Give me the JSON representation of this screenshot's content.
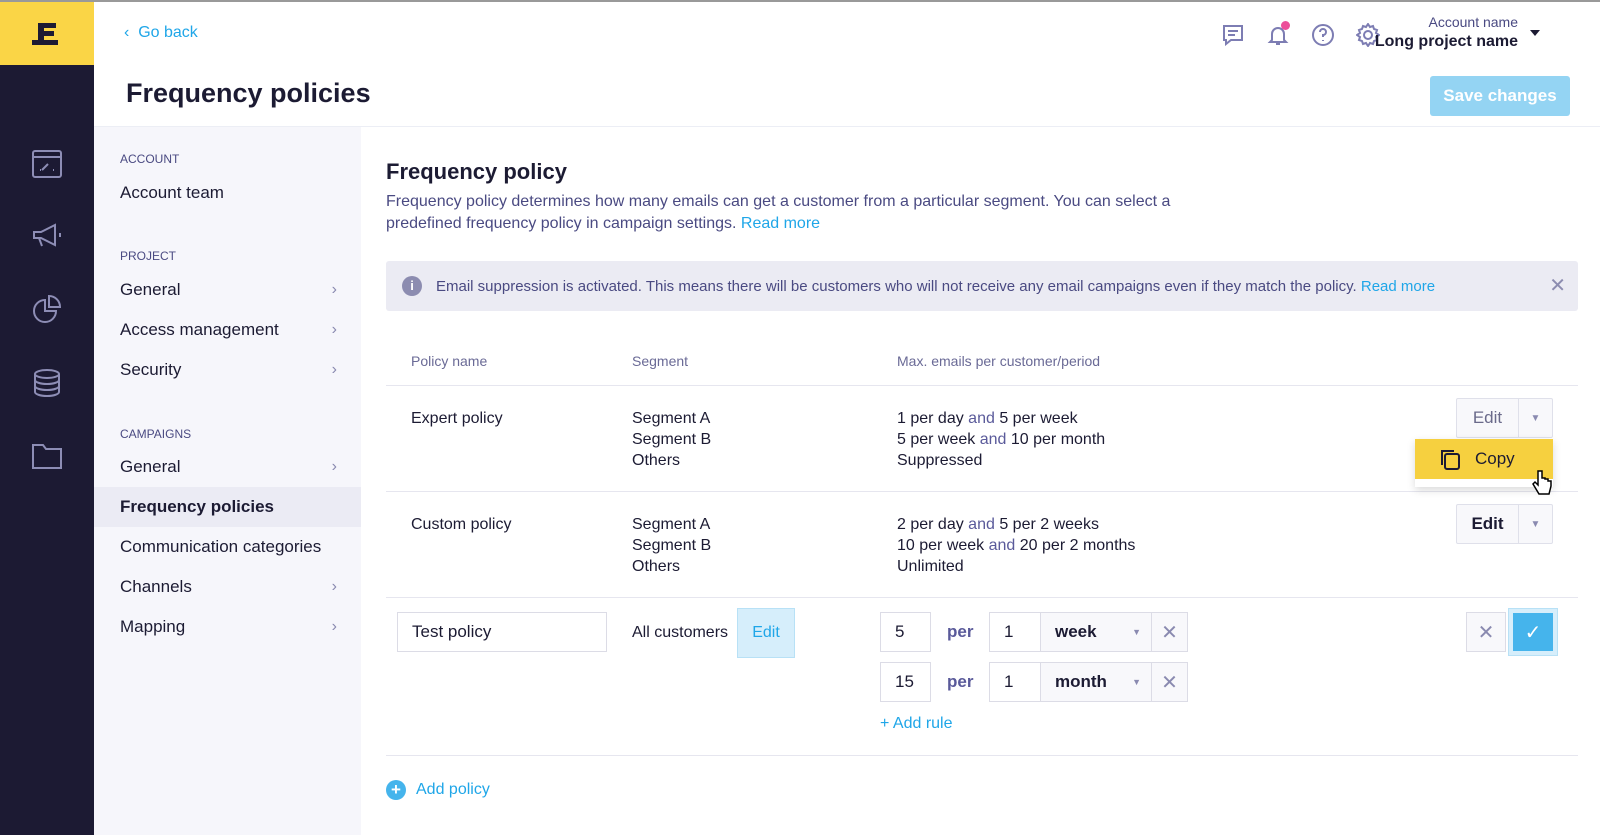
{
  "logo": "E",
  "rail": {
    "icons": [
      "dashboard-icon",
      "megaphone-icon",
      "pie-chart-icon",
      "database-icon",
      "folder-icon"
    ]
  },
  "header": {
    "go_back": "Go back",
    "title": "Frequency policies",
    "account_name": "Account name",
    "project_name": "Long project name",
    "save_label": "Save changes",
    "icons": [
      "chat-icon",
      "bell-icon",
      "help-icon",
      "gear-icon"
    ]
  },
  "sidebar": {
    "sections": [
      {
        "label": "ACCOUNT",
        "items": [
          {
            "label": "Account team"
          }
        ]
      },
      {
        "label": "PROJECT",
        "items": [
          {
            "label": "General"
          },
          {
            "label": "Access management"
          },
          {
            "label": "Security"
          }
        ]
      },
      {
        "label": "CAMPAIGNS",
        "items": [
          {
            "label": "General"
          },
          {
            "label": "Frequency policies",
            "active": true
          },
          {
            "label": "Communication categories"
          },
          {
            "label": "Channels"
          },
          {
            "label": "Mapping"
          }
        ]
      }
    ]
  },
  "main": {
    "heading": "Frequency policy",
    "description": "Frequency policy determines how many emails can get a customer from a particular segment. You can select a predefined frequency policy in campaign settings.",
    "read_more": "Read more",
    "banner": {
      "text": "Email suppression is activated. This means there will be customers  who will not receive any email campaigns even if they match the policy.",
      "link": "Read more"
    },
    "columns": [
      "Policy name",
      "Segment",
      "Max. emails per customer/period"
    ],
    "policies": [
      {
        "name": "Expert policy",
        "segments": [
          "Segment A",
          "Segment B",
          "Others"
        ],
        "rules": [
          [
            "1 per day",
            "and",
            "5 per week"
          ],
          [
            "5 per week",
            "and",
            "10 per month"
          ]
        ],
        "status": "Suppressed",
        "edit": "Edit"
      },
      {
        "name": "Custom policy",
        "segments": [
          "Segment A",
          "Segment B",
          "Others"
        ],
        "rules": [
          [
            "2 per day",
            "and",
            "5 per 2 weeks"
          ],
          [
            "10 per week",
            "and",
            "20 per 2 months"
          ]
        ],
        "status": "Unlimited",
        "edit": "Edit"
      }
    ],
    "copy_label": "Copy",
    "new_policy": {
      "name": "Test policy",
      "segment": "All customers",
      "segment_edit": "Edit",
      "per": "per",
      "rules": [
        {
          "count": "5",
          "period": "1",
          "unit": "week"
        },
        {
          "count": "15",
          "period": "1",
          "unit": "month"
        }
      ],
      "add_rule": "+ Add rule"
    },
    "add_policy": "Add policy"
  }
}
